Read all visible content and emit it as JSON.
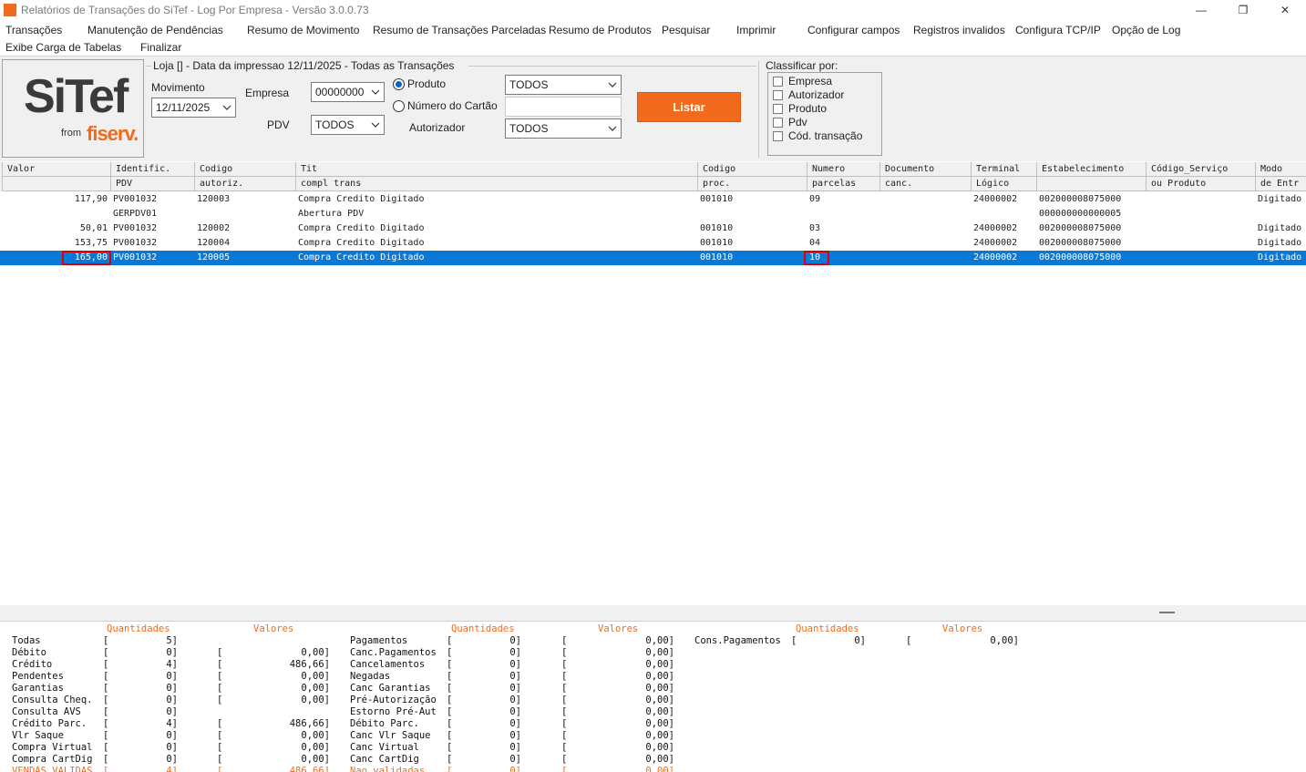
{
  "window": {
    "title": "Relatórios de Transações do SiTef - Log Por Empresa - Versão 3.0.0.73",
    "minimize": "—",
    "restore": "❐",
    "close": "✕"
  },
  "menu": {
    "row1": [
      "Transações",
      "Manutenção de Pendências",
      "Resumo de Movimento",
      "Resumo de Transações Parceladas",
      "Resumo de Produtos",
      "Pesquisar",
      "Imprimir",
      "Configurar campos",
      "Registros invalidos",
      "Configura TCP/IP",
      "Opção de Log"
    ],
    "row2": [
      "Exibe Carga de Tabelas",
      "Finalizar"
    ]
  },
  "logo": {
    "main": "SiTef",
    "from": "from",
    "brand": "fiserv."
  },
  "filters": {
    "group_title": "Loja [] - Data da impressao 12/11/2025 - Todas as Transações",
    "movimento_label": "Movimento",
    "movimento_value": "12/11/2025",
    "empresa_label": "Empresa",
    "empresa_value": "00000000",
    "pdv_label": "PDV",
    "pdv_value": "TODOS",
    "radio_produto": "Produto",
    "radio_cartao": "Número do Cartão",
    "produto_value": "TODOS",
    "cartao_value": "",
    "autorizador_label": "Autorizador",
    "autorizador_value": "TODOS",
    "listar_label": "Listar"
  },
  "sort": {
    "title": "Classificar por:",
    "options": [
      "Empresa",
      "Autorizador",
      "Produto",
      "Pdv",
      "Cód. transação"
    ]
  },
  "grid": {
    "header1": [
      "Valor",
      "Identific.",
      "Codigo",
      "Tit",
      "Codigo",
      "Numero",
      "Documento",
      "Terminal",
      "Estabelecimento",
      "Código_Serviço",
      "Modo"
    ],
    "header2": [
      "",
      "PDV",
      "autoriz.",
      "compl trans",
      "proc.",
      "parcelas",
      "canc.",
      "Lógico",
      "",
      "ou Produto",
      "de Entr"
    ],
    "rows": [
      [
        "117,90",
        "PV001032",
        "120003",
        "Compra Credito Digitado",
        "001010",
        "09",
        "",
        "24000002",
        "002000008075000",
        "",
        "Digitado"
      ],
      [
        "",
        "GERPDV01",
        "",
        "Abertura PDV",
        "",
        "",
        "",
        "",
        "000000000000005",
        "",
        ""
      ],
      [
        "50,01",
        "PV001032",
        "120002",
        "Compra Credito Digitado",
        "001010",
        "03",
        "",
        "24000002",
        "002000008075000",
        "",
        "Digitado"
      ],
      [
        "153,75",
        "PV001032",
        "120004",
        "Compra Credito Digitado",
        "001010",
        "04",
        "",
        "24000002",
        "002000008075000",
        "",
        "Digitado"
      ],
      [
        "165,00",
        "PV001032",
        "120005",
        "Compra Credito Digitado",
        "001010",
        "10",
        "",
        "24000002",
        "002000008075000",
        "",
        "Digitado"
      ]
    ]
  },
  "summary": {
    "headers": [
      "Quantidades",
      "Valores"
    ],
    "col1": [
      {
        "label": "Todas",
        "qty": "5",
        "val": null
      },
      {
        "label": "Débito",
        "qty": "0",
        "val": "0,00"
      },
      {
        "label": "Crédito",
        "qty": "4",
        "val": "486,66"
      },
      {
        "label": "Pendentes",
        "qty": "0",
        "val": "0,00"
      },
      {
        "label": "Garantias",
        "qty": "0",
        "val": "0,00"
      },
      {
        "label": "Consulta Cheq.",
        "qty": "0",
        "val": "0,00"
      },
      {
        "label": "Consulta AVS",
        "qty": "0",
        "val": null
      },
      {
        "label": "Crédito Parc.",
        "qty": "4",
        "val": "486,66"
      },
      {
        "label": "Vlr Saque",
        "qty": "0",
        "val": "0,00"
      },
      {
        "label": "Compra Virtual",
        "qty": "0",
        "val": "0,00"
      },
      {
        "label": "Compra CartDig",
        "qty": "0",
        "val": "0,00"
      },
      {
        "label": "VENDAS VALIDAS",
        "qty": "4",
        "val": "486,66",
        "orange": true
      }
    ],
    "col2": [
      {
        "label": "Pagamentos",
        "qty": "0",
        "val": "0,00"
      },
      {
        "label": "Canc.Pagamentos",
        "qty": "0",
        "val": "0,00"
      },
      {
        "label": "Cancelamentos",
        "qty": "0",
        "val": "0,00"
      },
      {
        "label": "Negadas",
        "qty": "0",
        "val": "0,00"
      },
      {
        "label": "Canc Garantias",
        "qty": "0",
        "val": "0,00"
      },
      {
        "label": "Pré-Autorização",
        "qty": "0",
        "val": "0,00"
      },
      {
        "label": "Estorno Pré-Aut",
        "qty": "0",
        "val": "0,00"
      },
      {
        "label": "Débito Parc.",
        "qty": "0",
        "val": "0,00"
      },
      {
        "label": "Canc Vlr Saque",
        "qty": "0",
        "val": "0,00"
      },
      {
        "label": "Canc Virtual",
        "qty": "0",
        "val": "0,00"
      },
      {
        "label": "Canc CartDig",
        "qty": "0",
        "val": "0,00"
      },
      {
        "label": "Nao validadas",
        "qty": "0",
        "val": "0,00",
        "orange": true
      }
    ],
    "col3": [
      {
        "label": "Cons.Pagamentos",
        "qty": "0",
        "val": "0,00"
      }
    ]
  }
}
